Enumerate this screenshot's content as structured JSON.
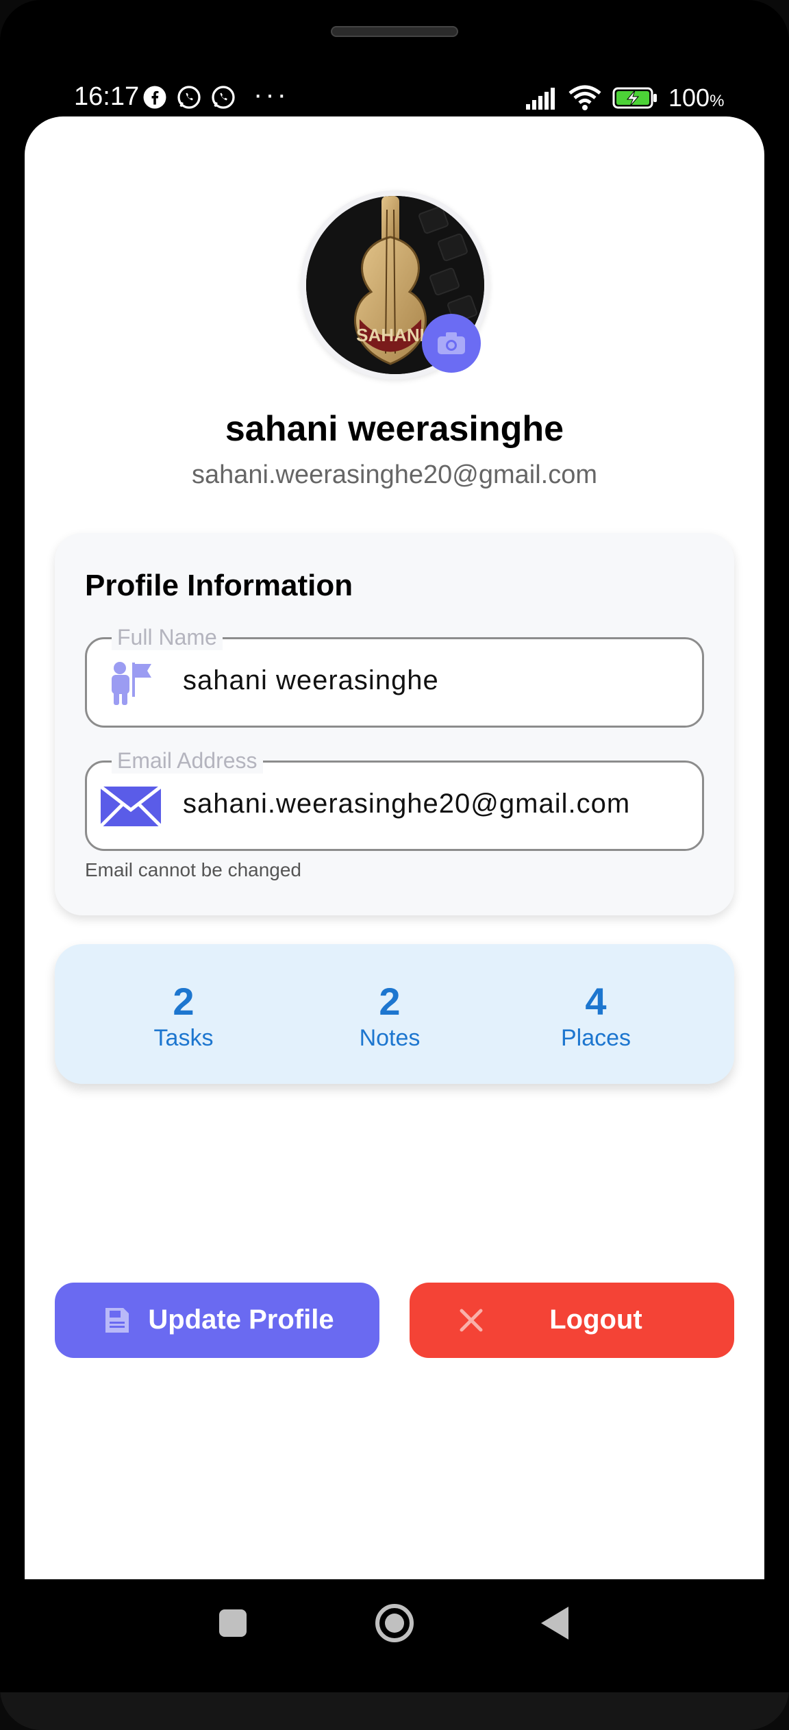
{
  "status_bar": {
    "time": "16:17",
    "left_icons": [
      "facebook-icon",
      "whatsapp-icon",
      "whatsapp-icon"
    ],
    "more": "···",
    "battery_percent": "100",
    "battery_unit": "%"
  },
  "profile": {
    "name": "sahani weerasinghe",
    "email": "sahani.weerasinghe20@gmail.com"
  },
  "info_card": {
    "title": "Profile Information",
    "full_name": {
      "label": "Full Name",
      "value": "sahani weerasinghe"
    },
    "email": {
      "label": "Email Address",
      "value": "sahani.weerasinghe20@gmail.com",
      "helper": "Email cannot be changed"
    }
  },
  "stats": [
    {
      "value": "2",
      "label": "Tasks"
    },
    {
      "value": "2",
      "label": "Notes"
    },
    {
      "value": "4",
      "label": "Places"
    }
  ],
  "actions": {
    "update_label": "Update Profile",
    "logout_label": "Logout"
  },
  "colors": {
    "primary": "#6a6af1",
    "danger": "#f44336",
    "stats_bg": "#e3f1fc",
    "stats_text": "#1d76cf"
  }
}
